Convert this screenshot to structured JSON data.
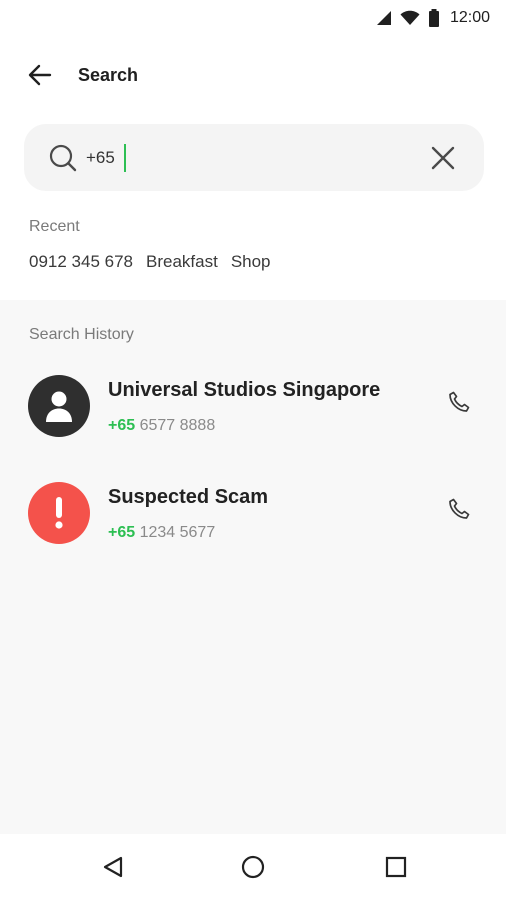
{
  "status_bar": {
    "time": "12:00",
    "icons": [
      "cellular-signal-icon",
      "wifi-icon",
      "battery-icon"
    ]
  },
  "toolbar": {
    "back_icon": "arrow-left-icon",
    "title": "Search"
  },
  "search": {
    "value": "+65",
    "search_icon": "search-icon",
    "clear_icon": "close-icon"
  },
  "recent": {
    "label": "Recent",
    "items": [
      "0912 345 678",
      "Breakfast",
      "Shop"
    ]
  },
  "history": {
    "label": "Search History",
    "items": [
      {
        "name": "Universal Studios Singapore",
        "prefix": "+65",
        "number": "6577 8888",
        "avatar_icon": "person-icon",
        "avatar_color": "#2f2f2f"
      },
      {
        "name": "Suspected Scam",
        "prefix": "+65",
        "number": "1234 5677",
        "avatar_icon": "exclamation-icon",
        "avatar_color": "#f4524b"
      }
    ]
  },
  "nav": {
    "icons": [
      "back-triangle-icon",
      "home-circle-icon",
      "recents-square-icon"
    ]
  },
  "colors": {
    "accent_green": "#2dbf53",
    "scam_red": "#f4524b",
    "history_bg": "#f8f8f8"
  }
}
